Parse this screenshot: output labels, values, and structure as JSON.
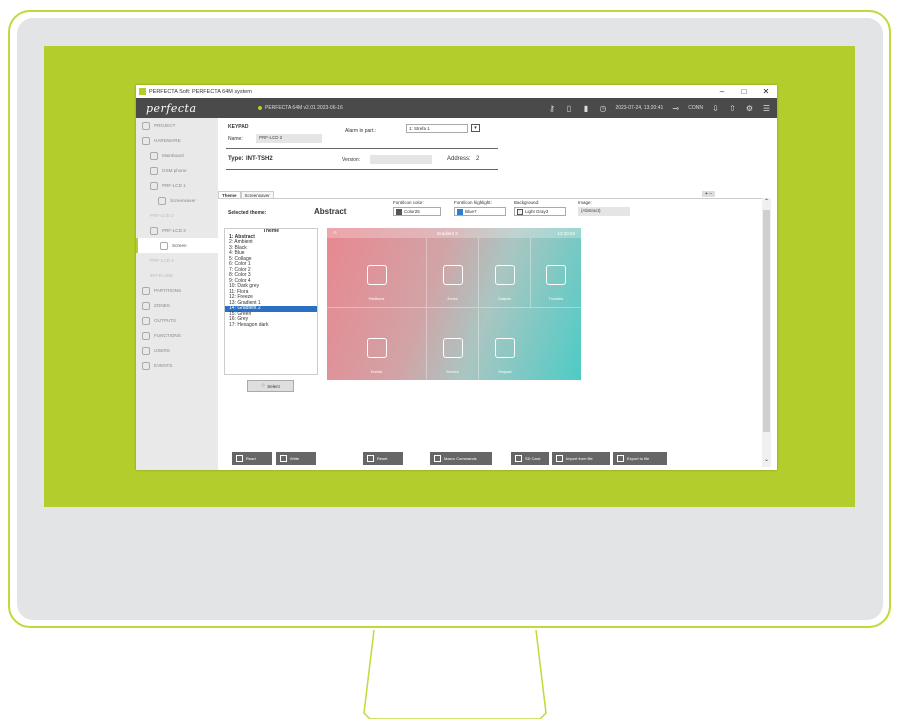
{
  "window": {
    "title": "PERFECTA Soft: PERFECTA 64M system",
    "minimize": "–",
    "maximize": "□",
    "close": "✕"
  },
  "topbar": {
    "logo": "perfecta",
    "version": "PERFECTA 64M v2.01 2023-06-16",
    "datetime": "2023-07-24, 13:20:41",
    "conn": "CONN"
  },
  "sidebar": {
    "items": [
      {
        "label": "PROJECT"
      },
      {
        "label": "HARDWARE"
      },
      {
        "label": "Mainboard"
      },
      {
        "label": "GSM phone"
      },
      {
        "label": "PRF-LCD 1"
      },
      {
        "label": "Screensaver"
      },
      {
        "label": "PRF-LCD 2"
      },
      {
        "label": "PRF-LCD 3"
      },
      {
        "label": "Screen"
      },
      {
        "label": "PRF-LCD 4"
      },
      {
        "label": "INT-R-USB"
      },
      {
        "label": "PARTITIONS"
      },
      {
        "label": "ZONES"
      },
      {
        "label": "OUTPUTS"
      },
      {
        "label": "FUNCTIONS"
      },
      {
        "label": "USERS"
      },
      {
        "label": "EVENTS"
      }
    ]
  },
  "keypad": {
    "heading": "KEYPAD",
    "name_label": "Name:",
    "name_value": "PRF-LCD 2",
    "alarm_label": "Alarm in part.:",
    "alarm_value": "1: Strefa 1",
    "type_label": "Type:",
    "type_value": "INT-TSH2",
    "version_label": "Version:",
    "address_label": "Address:",
    "address_value": "2"
  },
  "tabs": {
    "theme": "Theme",
    "screensaver": "Screensaver",
    "plus": "+",
    "minus": "−"
  },
  "theme": {
    "selected_label": "Selected theme:",
    "selected_value": "Abstract",
    "font_color_label": "Font/icon color:",
    "font_color_value": "Color25",
    "font_highlight_label": "Font/icon highlight:",
    "font_highlight_value": "Blue7",
    "background_label": "Background:",
    "background_value": "Light Gray3",
    "image_label": "Image:",
    "image_value": "(Abstract)",
    "list_header": "Theme",
    "list": [
      "1: Abstract",
      "2: Ambient",
      "3: Black",
      "4: Blue",
      "5: Collage",
      "6: Color 1",
      "7: Color 2",
      "8: Color 3",
      "9: Color 4",
      "10: Dark grey",
      "11: Flora",
      "12: Freeze",
      "13: Gradient 1",
      "14: Gradient 2",
      "15: Green",
      "16: Grey",
      "17: Hexagon dark"
    ],
    "select_button": "Select"
  },
  "preview": {
    "header": "Gradient 2",
    "time": "13:20:02",
    "tiles": [
      "Partitions",
      "Zones",
      "Outputs",
      "Troubles",
      "Events",
      "Service",
      "Keypad"
    ]
  },
  "buttons": {
    "read": "Read",
    "write": "Write",
    "reset": "Reset",
    "macro": "Macro Commands",
    "sd_card": "SD Card",
    "import": "Import from file",
    "export": "Export to file"
  },
  "colors": {
    "brand_green": "#b3ce2c",
    "topbar": "#4a4a4a",
    "selection": "#2a6fc2"
  }
}
